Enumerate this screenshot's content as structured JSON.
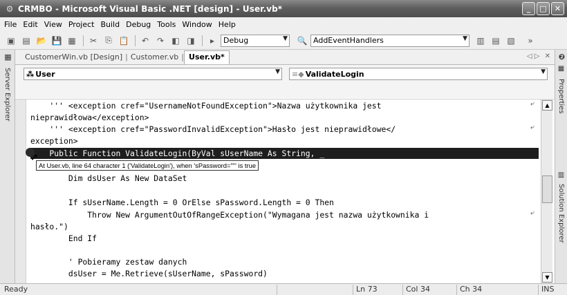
{
  "window": {
    "app_icon": "crmbo-app-icon",
    "title": "CRMBO - Microsoft Visual Basic .NET [design] - User.vb*"
  },
  "menu": [
    "File",
    "Edit",
    "View",
    "Project",
    "Build",
    "Debug",
    "Tools",
    "Window",
    "Help"
  ],
  "toolbar": {
    "config_combo": "Debug",
    "find_combo": "AddEventHandlers"
  },
  "left_sidebar": {
    "server_explorer": "Server Explorer"
  },
  "right_sidebar": {
    "properties": "Properties",
    "solution_explorer": "Solution Explorer"
  },
  "tabs": [
    "CustomerWin.vb [Design]",
    "Customer.vb",
    "User.vb*"
  ],
  "object_combo": "User",
  "member_combo": "ValidateLogin",
  "code_lines": [
    "    ''' <exception cref=\"UsernameNotFoundException\">Nazwa użytkownika jest",
    "nieprawidłowa</exception>",
    "    ''' <exception cref=\"PasswordInvalidException\">Hasło jest nieprawidłowe</",
    "exception>",
    "    Public Function ValidateLogin(ByVal sUserName As String, _",
    "",
    "        Dim dsUser As New DataSet",
    "",
    "        If sUserName.Length = 0 OrElse sPassword.Length = 0 Then",
    "            Throw New ArgumentOutOfRangeException(\"Wymagana jest nazwa użytkownika i",
    "hasło.\")",
    "        End If",
    "",
    "        ' Pobieramy zestaw danych",
    "        dsUser = Me.Retrieve(sUserName, sPassword)"
  ],
  "tooltip": "At User.vb, line 64 character 1 ('ValidateLogin'), when 'sPassword=\"\"' is true",
  "status": {
    "ready": "Ready",
    "line": "Ln 73",
    "col": "Col 34",
    "ch": "Ch 34",
    "ins": "INS"
  }
}
